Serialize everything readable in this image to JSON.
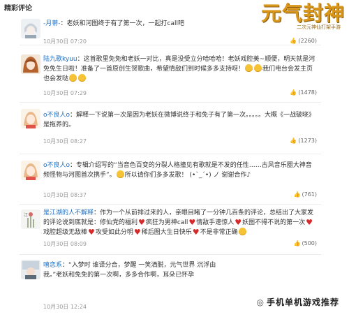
{
  "section_title": "精彩评论",
  "logo": {
    "main": "元气封神",
    "sub": "二次元神仙打架手游"
  },
  "comments": [
    {
      "user": "-月蒂-",
      "text": "老妖和河图终于有了第一次，一起打call吧",
      "time": "10月30日 07:20",
      "likes": "(2260)"
    },
    {
      "user": "陆九歌kyuu",
      "text_a": "这首歌里免免和老妖一对比，真是没受立分哈哈哈！老妖戏腔美~顺便，明天就是河免免生日啦！准备了一首原创生贺歌曲，希望情敌们到时候多多支持呀！",
      "text_b": "我们电台会发主页也会发哒",
      "time": "10月30日 07:29",
      "likes": "(1478)"
    },
    {
      "user": "o不良人o",
      "text": "解释一下说第一次是因为老妖在微博说终于和免子有了第一次。。。。。大概《一战破晓》是拖养的。",
      "time": "10月30日 08:27",
      "likes": "(1273)"
    },
    {
      "user": "o不良人o",
      "text_a": "专辑介绍写的“当音色百变的分裂人格撞见有歌就是不发的任性……古风音乐圈大神音频怪物与河图首次携手”。",
      "text_b": "所以请你们多多发歌！ (•ˋ_ˊ•) ノ 谢谢合作♪",
      "time": "10月30日 08:37",
      "likes": "(761)"
    },
    {
      "user": "是江湖的人不解释",
      "text_1": "作为一个从前排过来的人，亲眼目睹了一分钟几百条的评论，总结出了大家发的评论说到底就是：修仙党的福利",
      "text_2": "疯狂为男神call",
      "text_3": "情敌手速惊人",
      "text_4": "妖图不得不说的第一次",
      "text_5": "戏腔超级无敌棒",
      "text_6": "攻受如此分明",
      "text_7": "稀后图大生日快乐",
      "text_8": "不是非常正确",
      "time": "10月30日 08:09",
      "likes": "(500)"
    },
    {
      "user": "嘻恋系",
      "text": "“入梦时 谁译分合，梦醒 一笑洒脱，元气世界 沉浮由我。”老妖和免免的第一次啊，多多合作啊，耳朵已怀孕",
      "time": "10月30日 12:24",
      "likes": ""
    }
  ],
  "watermark": "手机单机游戏推荐",
  "colors": {
    "username": "#1f6fc2",
    "heart": "#d62a2a",
    "emoji": "#f6c337",
    "logo": "#d8961a"
  },
  "icons": [
    "thumbs-up-icon",
    "smile-emoji-icon",
    "heart-icon",
    "wechat-icon"
  ]
}
